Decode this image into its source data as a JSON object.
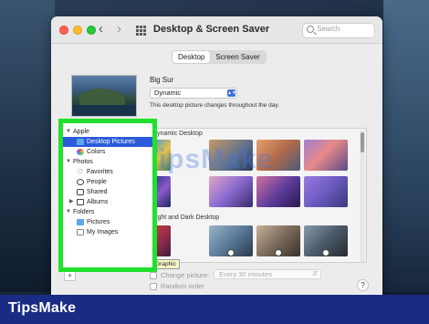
{
  "window": {
    "title": "Desktop & Screen Saver",
    "search_placeholder": "Search"
  },
  "tabs": [
    "Desktop",
    "Screen Saver"
  ],
  "picture": {
    "name": "Big Sur",
    "mode": "Dynamic",
    "description": "This desktop picture changes throughout the day."
  },
  "sidebar": {
    "apple": {
      "label": "Apple",
      "items": [
        "Desktop Pictures",
        "Colors"
      ]
    },
    "photos": {
      "label": "Photos",
      "items": [
        "Favorites",
        "People",
        "Shared",
        "Albums"
      ]
    },
    "folders": {
      "label": "Folders",
      "items": [
        "Pictures",
        "My Images"
      ]
    }
  },
  "content": {
    "section1": "Dynamic Desktop",
    "section2": "Light and Dark Desktop",
    "tooltip": "Big Sur Graphic"
  },
  "options": {
    "change_picture_label": "Change picture:",
    "interval": "Every 30 minutes",
    "random_label": "Random order"
  },
  "help": "?",
  "plus": "+",
  "brand": "TipsMake",
  "watermark": "TipsMake",
  "colors": {
    "highlight": "#22e02e",
    "brand_bar": "#1a2b84",
    "selection": "#2b5bd8"
  }
}
